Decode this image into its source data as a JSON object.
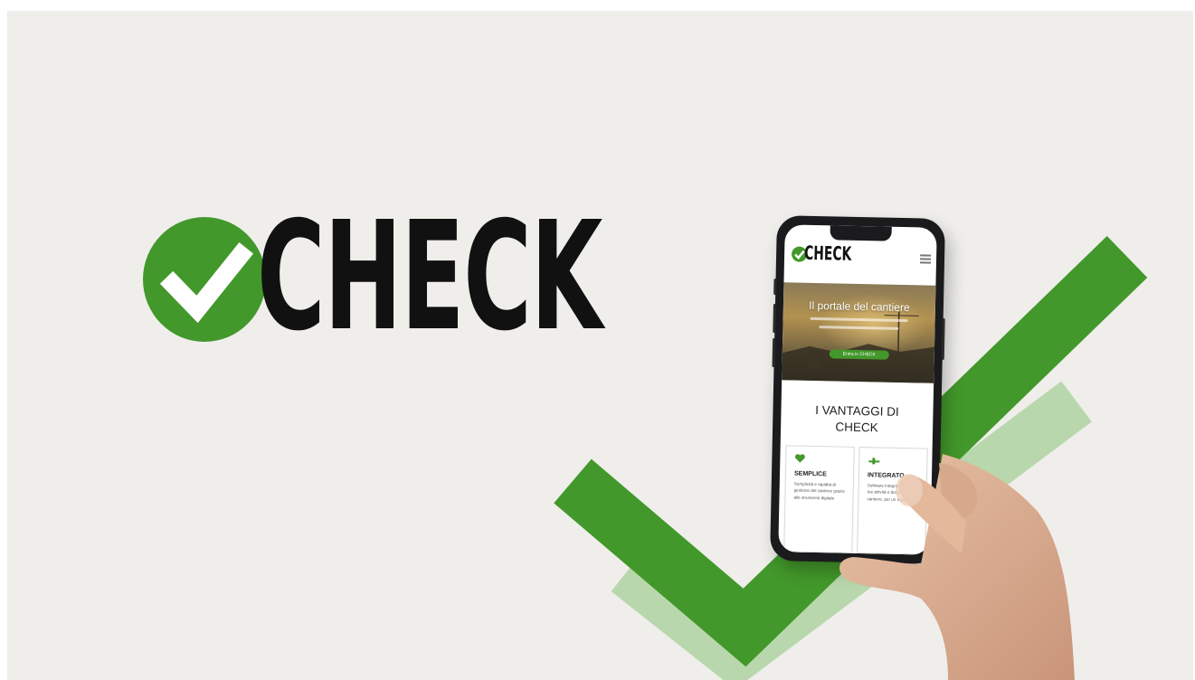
{
  "brand": {
    "name": "CHECK",
    "color": "#42982a",
    "text_color": "#111111"
  },
  "phone_app": {
    "logo_text": "CHECK",
    "menu_icon": "hamburger-menu-icon",
    "hero": {
      "title": "Il portale del cantiere",
      "cta_label": "Entra in CHECK"
    },
    "section_title_line1": "I VANTAGGI DI",
    "section_title_line2": "CHECK",
    "cards": [
      {
        "icon": "heart-icon",
        "title": "SEMPLICE",
        "text": "Semplicità e rapidità di gestione del cantiere grazie allo strumento digitale"
      },
      {
        "icon": "puzzle-icon",
        "title": "INTEGRATO",
        "text": "Software integrato con le tue attività e documenti del cantiere, per un supporto"
      }
    ]
  }
}
